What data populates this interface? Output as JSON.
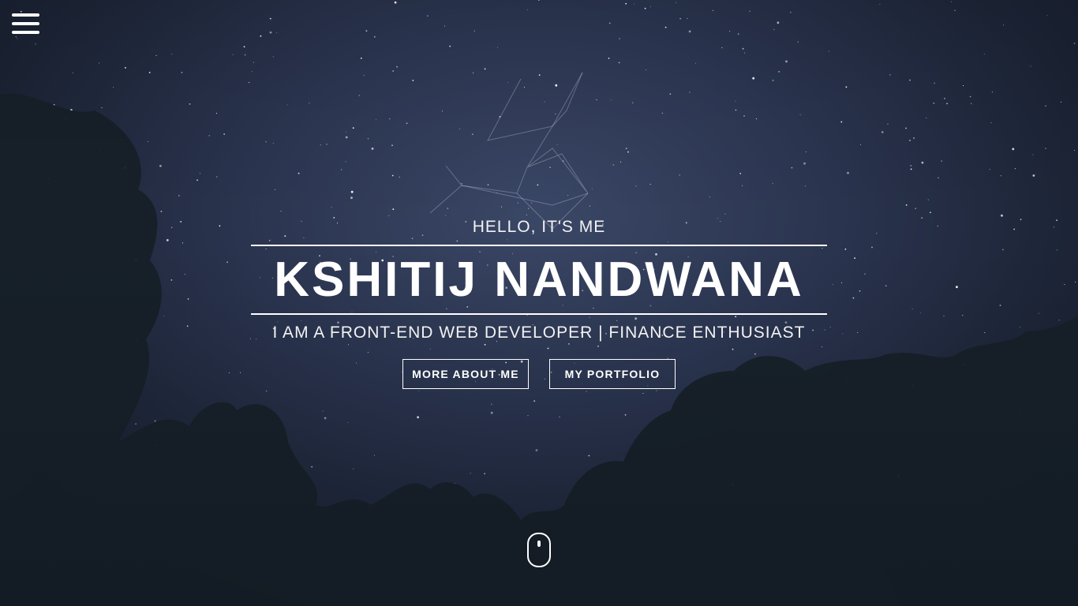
{
  "nav": {
    "menu_icon": "hamburger-menu-icon"
  },
  "hero": {
    "greeting": "HELLO, IT'S ME",
    "name": "KSHITIJ NANDWANA",
    "tagline": "I AM A FRONT-END WEB DEVELOPER | FINANCE ENTHUSIAST",
    "buttons": {
      "about_label": "MORE ABOUT ME",
      "portfolio_label": "MY PORTFOLIO"
    },
    "scroll_icon": "mouse-scroll-icon"
  },
  "colors": {
    "text": "#ffffff",
    "sky_light": "#3a4766",
    "sky_dark": "#141b28",
    "trees": "#172029"
  }
}
